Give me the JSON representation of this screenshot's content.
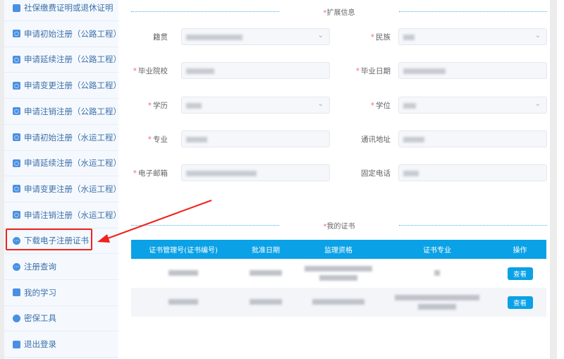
{
  "sidebar": {
    "items": [
      {
        "label": "社保缴费证明或退休证明",
        "icon": "certificate-icon"
      },
      {
        "label": "申请初始注册（公路工程）",
        "icon": "camera-icon"
      },
      {
        "label": "申请延续注册（公路工程）",
        "icon": "camera-icon"
      },
      {
        "label": "申请变更注册（公路工程）",
        "icon": "camera-icon"
      },
      {
        "label": "申请注销注册（公路工程）",
        "icon": "camera-icon"
      },
      {
        "label": "申请初始注册（水运工程）",
        "icon": "camera-icon"
      },
      {
        "label": "申请延续注册（水运工程）",
        "icon": "camera-icon"
      },
      {
        "label": "申请变更注册（水运工程）",
        "icon": "camera-icon"
      },
      {
        "label": "申请注销注册（水运工程）",
        "icon": "camera-icon"
      },
      {
        "label": "下载电子注册证书",
        "icon": "more-icon",
        "highlighted": true
      },
      {
        "label": "注册查询",
        "icon": "more-icon"
      },
      {
        "label": "我的学习",
        "icon": "book-icon"
      },
      {
        "label": "密保工具",
        "icon": "shield-icon"
      },
      {
        "label": "退出登录",
        "icon": "logout-icon"
      }
    ]
  },
  "extended": {
    "title": "扩展信息",
    "fields": [
      {
        "label": "籍贯",
        "required": false,
        "type": "select"
      },
      {
        "label": "民族",
        "required": true,
        "type": "select"
      },
      {
        "label": "毕业院校",
        "required": true,
        "type": "input"
      },
      {
        "label": "毕业日期",
        "required": true,
        "type": "input"
      },
      {
        "label": "学历",
        "required": true,
        "type": "select"
      },
      {
        "label": "学位",
        "required": true,
        "type": "select"
      },
      {
        "label": "专业",
        "required": true,
        "type": "input"
      },
      {
        "label": "通讯地址",
        "required": false,
        "type": "input"
      },
      {
        "label": "电子邮箱",
        "required": true,
        "type": "input"
      },
      {
        "label": "固定电话",
        "required": false,
        "type": "input"
      }
    ]
  },
  "certificates": {
    "title": "我的证书",
    "columns": [
      "证书管理号(证书编号)",
      "批准日期",
      "监理资格",
      "证书专业",
      "操作"
    ],
    "rows": [
      {
        "action": "查看"
      },
      {
        "action": "查看"
      }
    ]
  },
  "colors": {
    "accent": "#0aa1e6",
    "annotation": "#f0231c"
  }
}
